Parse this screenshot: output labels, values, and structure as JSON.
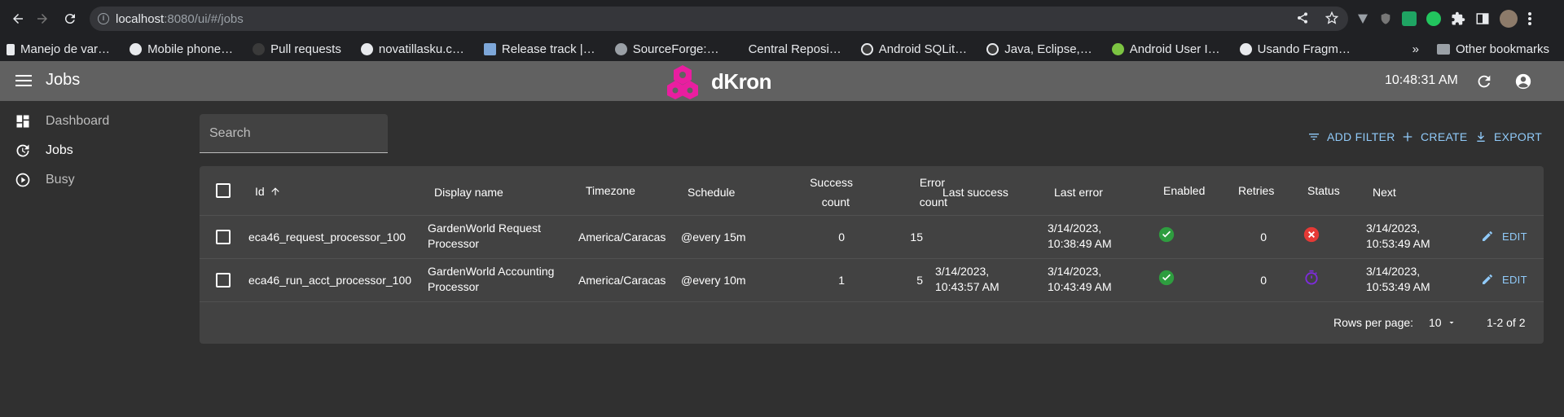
{
  "browser": {
    "url_host": "localhost",
    "url_path": ":8080/ui/#/jobs",
    "bookmarks": [
      {
        "label": "Manejo de var…",
        "color": "#e8eaed"
      },
      {
        "label": "Mobile phone…",
        "color": "#ffffff"
      },
      {
        "label": "Pull requests",
        "color": "#333333"
      },
      {
        "label": "novatillasku.c…",
        "color": "#ffffff"
      },
      {
        "label": "Release track |…",
        "color": "#7da7d9"
      },
      {
        "label": "SourceForge:…",
        "color": "#9aa0a6"
      },
      {
        "label": "Central Reposi…",
        "color": "#202124"
      },
      {
        "label": "Android SQLit…",
        "color": "#ffffff"
      },
      {
        "label": "Java, Eclipse,…",
        "color": "#ffffff"
      },
      {
        "label": "Android User I…",
        "color": "#7cc442"
      },
      {
        "label": "Usando Fragm…",
        "color": "#ffffff"
      }
    ],
    "other_bookmarks": "Other bookmarks",
    "more": "»"
  },
  "appbar": {
    "title": "Jobs",
    "logo_text": "dKron",
    "clock": "10:48:31 AM"
  },
  "sidebar": {
    "items": [
      {
        "label": "Dashboard",
        "active": false
      },
      {
        "label": "Jobs",
        "active": true
      },
      {
        "label": "Busy",
        "active": false
      }
    ]
  },
  "toolbar": {
    "search_placeholder": "Search",
    "add_filter": "ADD FILTER",
    "create": "CREATE",
    "export": "EXPORT"
  },
  "table": {
    "headers": {
      "id": "Id",
      "display_name": "Display name",
      "timezone": "Timezone",
      "schedule": "Schedule",
      "success_count_1": "Success",
      "success_count_2": "count",
      "error_count_1": "Error",
      "error_count_2": "count",
      "last_success": "Last success",
      "last_error": "Last error",
      "enabled": "Enabled",
      "retries": "Retries",
      "status": "Status",
      "next": "Next"
    },
    "rows": [
      {
        "id": "eca46_request_processor_100",
        "display_name_1": "GardenWorld Request",
        "display_name_2": "Processor",
        "timezone": "America/Caracas",
        "schedule": "@every 15m",
        "success_count": "0",
        "error_count": "15",
        "last_success_1": "",
        "last_success_2": "",
        "last_error_1": "3/14/2023,",
        "last_error_2": "10:38:49 AM",
        "enabled": true,
        "retries": "0",
        "status": "failed",
        "next_1": "3/14/2023,",
        "next_2": "10:53:49 AM",
        "edit": "EDIT"
      },
      {
        "id": "eca46_run_acct_processor_100",
        "display_name_1": "GardenWorld Accounting",
        "display_name_2": "Processor",
        "timezone": "America/Caracas",
        "schedule": "@every 10m",
        "success_count": "1",
        "error_count": "5",
        "last_success_1": "3/14/2023,",
        "last_success_2": "10:43:57 AM",
        "last_error_1": "3/14/2023,",
        "last_error_2": "10:43:49 AM",
        "enabled": true,
        "retries": "0",
        "status": "running",
        "next_1": "3/14/2023,",
        "next_2": "10:53:49 AM",
        "edit": "EDIT"
      }
    ],
    "footer": {
      "rows_per_page_label": "Rows per page:",
      "rows_per_page": "10",
      "range": "1-2 of 2"
    }
  },
  "colors": {
    "accent": "#90caf9",
    "enabled": "#2e9d3f",
    "failed": "#e53935",
    "running": "#7e2bdc",
    "logo": "#e91ea0"
  }
}
